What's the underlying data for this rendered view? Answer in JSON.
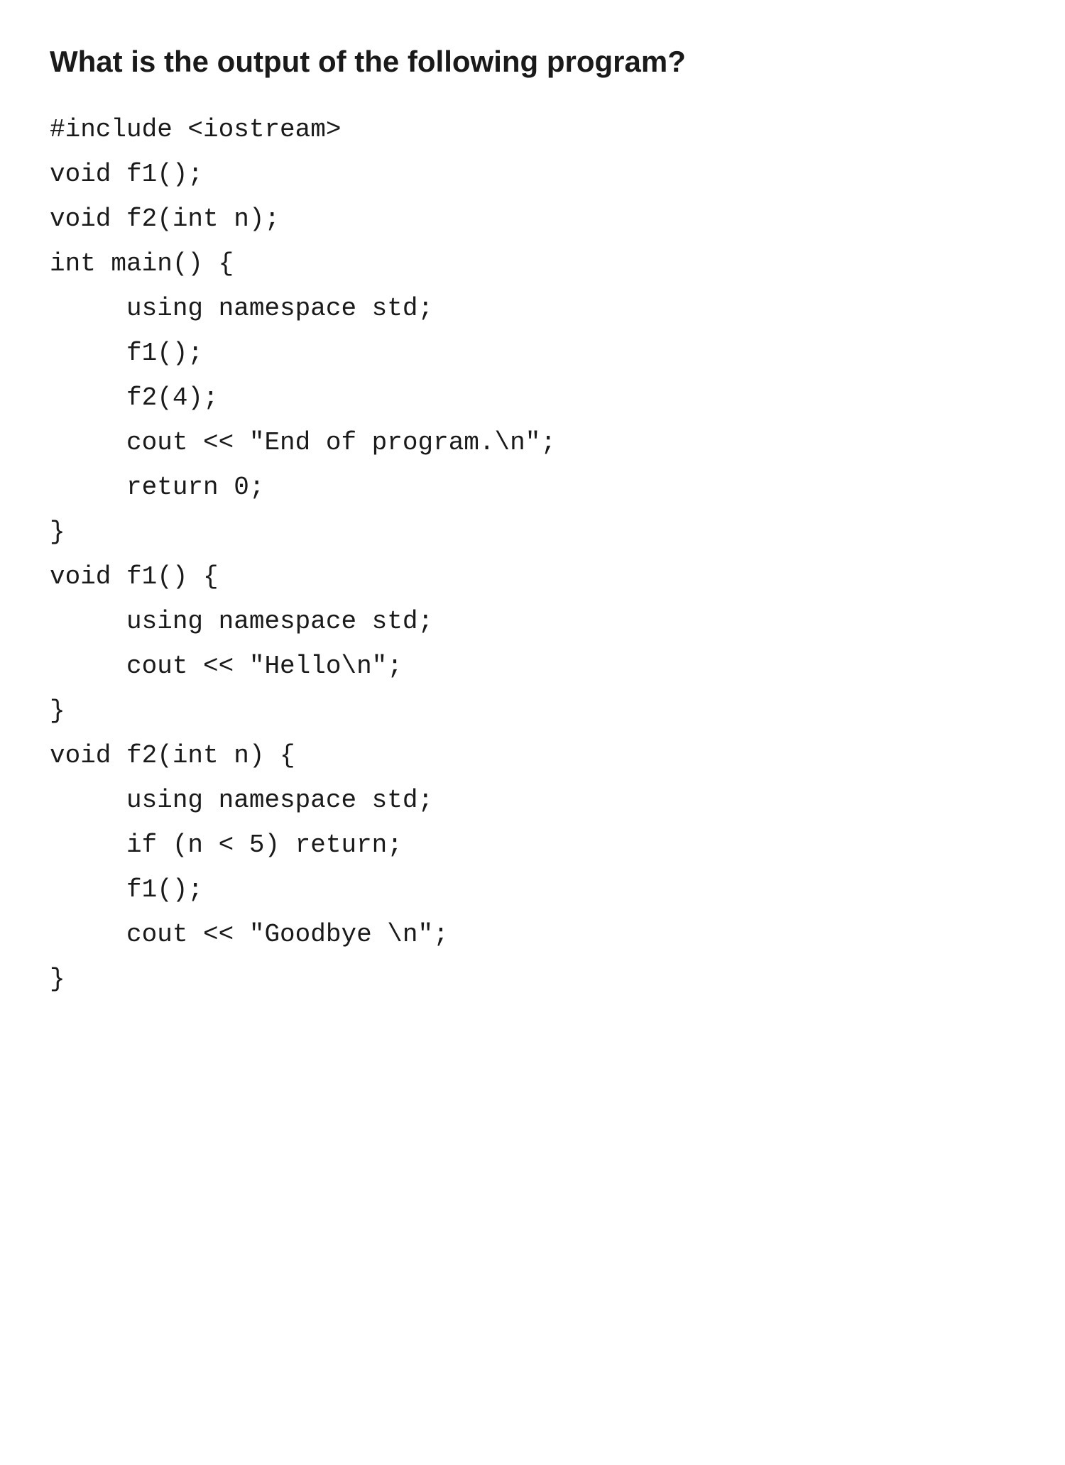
{
  "page": {
    "title": "What is the output of the following program?",
    "code_lines": [
      "#include <iostream>",
      "void f1();",
      "void f2(int n);",
      "int main() {",
      "     using namespace std;",
      "     f1();",
      "     f2(4);",
      "     cout << \"End of program.\\n\";",
      "     return 0;",
      "}",
      "void f1() {",
      "     using namespace std;",
      "     cout << \"Hello\\n\";",
      "}",
      "void f2(int n) {",
      "     using namespace std;",
      "     if (n < 5) return;",
      "     f1();",
      "     cout << \"Goodbye \\n\";",
      "}"
    ]
  }
}
